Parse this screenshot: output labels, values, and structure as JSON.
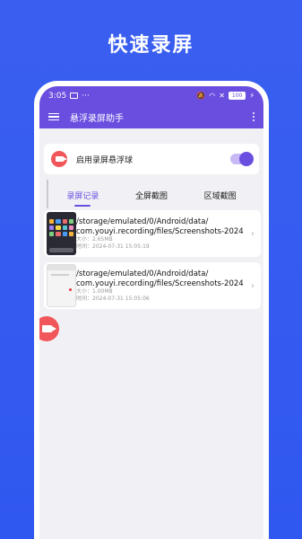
{
  "hero": {
    "title": "快速录屏"
  },
  "status": {
    "time": "3:05",
    "battery": "100"
  },
  "app_bar": {
    "title": "悬浮录屏助手"
  },
  "floating_toggle": {
    "label": "启用录屏悬浮球",
    "enabled": true
  },
  "tabs": [
    {
      "label": "录屏记录",
      "active": true
    },
    {
      "label": "全屏截图",
      "active": false
    },
    {
      "label": "区域截图",
      "active": false
    }
  ],
  "records": [
    {
      "path_line1": "/storage/emulated/0/Android/data/",
      "path_line2": "com.youyi.recording/files/Screenshots-2024",
      "size": "大小：2.65MB",
      "time": "时间：2024-07-31 15:05:19"
    },
    {
      "path_line1": "/storage/emulated/0/Android/data/",
      "path_line2": "com.youyi.recording/files/Screenshots-2024",
      "size": "大小：1.00MB",
      "time": "时间：2024-07-31 15:05:06"
    }
  ],
  "colors": {
    "primary": "#6a4ee0",
    "accent": "#f0565a",
    "background": "#2f58f0"
  }
}
